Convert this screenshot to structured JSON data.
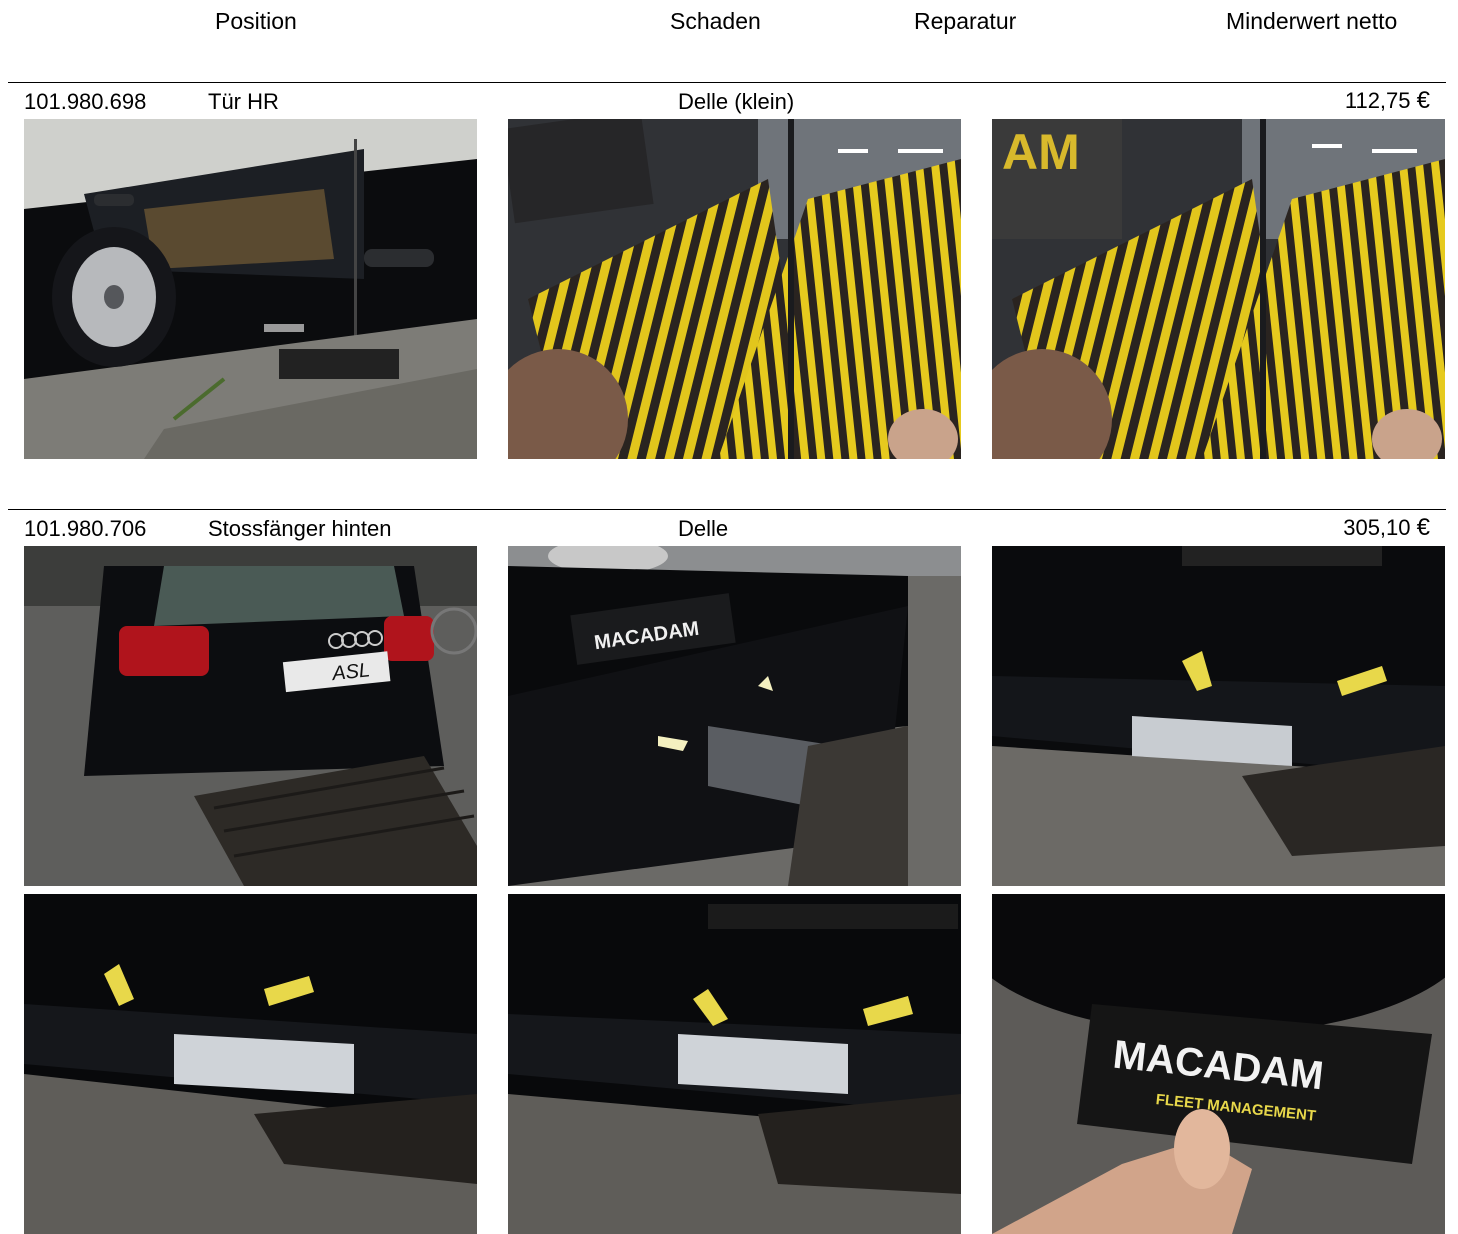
{
  "header": {
    "position": "Position",
    "schaden": "Schaden",
    "reparatur": "Reparatur",
    "minderwert": "Minderwert netto"
  },
  "items": [
    {
      "number": "101.980.698",
      "part": "Tür HR",
      "damage": "Delle (klein)",
      "amount": "112,75",
      "currency": "€",
      "photos": [
        "rear-door-overview-photo",
        "dent-gauge-closeup-photo",
        "dent-gauge-closeup-photo-2"
      ]
    },
    {
      "number": "101.980.706",
      "part": "Stossfänger hinten",
      "damage": "Delle",
      "amount": "305,10",
      "currency": "€",
      "photos": [
        "rear-bumper-overview-photo",
        "bumper-dent-gauge-photo",
        "bumper-dent-arrows-photo",
        "bumper-dent-arrows-photo-2",
        "bumper-dent-arrows-photo-3",
        "macadam-gauge-photo"
      ],
      "gauge_brand": "MACADAM",
      "gauge_subtitle": "FLEET MANAGEMENT",
      "plate_text": "ASL"
    }
  ]
}
